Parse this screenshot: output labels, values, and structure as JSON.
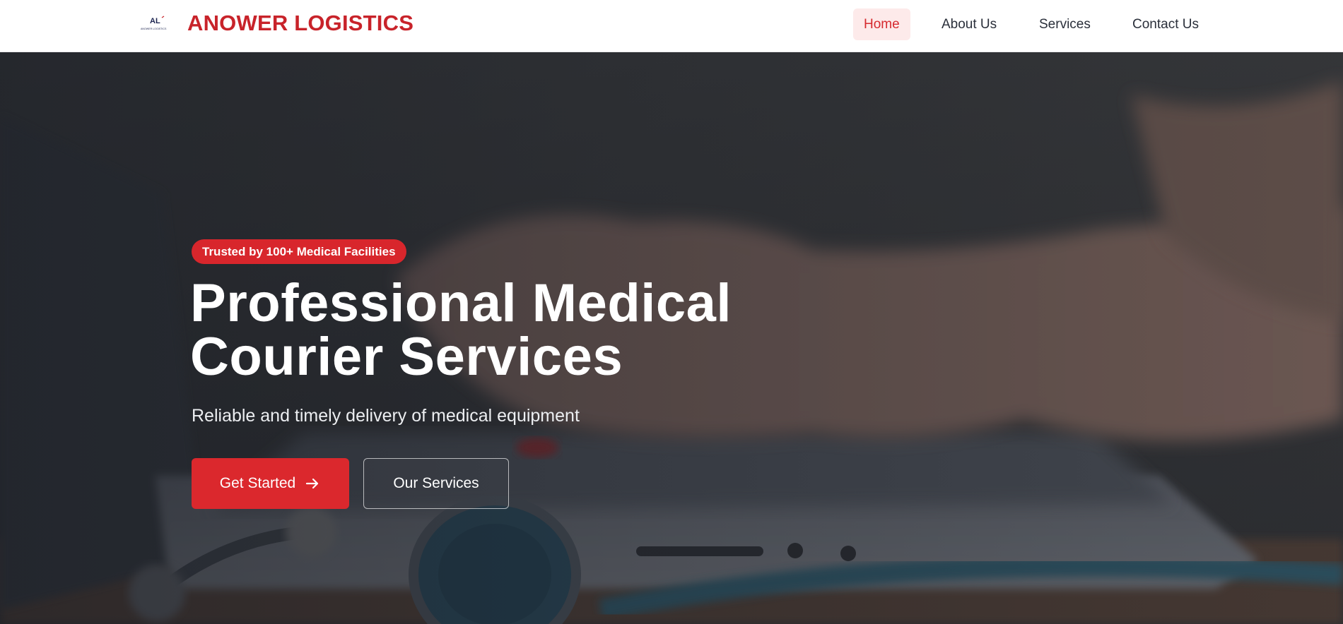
{
  "header": {
    "logo_text": "AL",
    "logo_subtext": "ANOWER LOGISTICS",
    "brand": "ANOWER LOGISTICS",
    "nav": [
      {
        "label": "Home",
        "active": true
      },
      {
        "label": "About Us",
        "active": false
      },
      {
        "label": "Services",
        "active": false
      },
      {
        "label": "Contact Us",
        "active": false
      }
    ]
  },
  "hero": {
    "badge": "Trusted by 100+ Medical Facilities",
    "headline_line1": "Professional Medical",
    "headline_line2": "Courier Services",
    "subtitle": "Reliable and timely delivery of medical equipment",
    "primary_button": "Get Started",
    "primary_button_icon": "arrow-right-icon",
    "secondary_button": "Our Services",
    "background": "hands typing on laptop with stethoscope"
  },
  "colors": {
    "brand_red": "#c8232a",
    "button_red": "#db282d",
    "nav_active_bg": "#fdeaea",
    "nav_text": "#2a2f3a"
  }
}
